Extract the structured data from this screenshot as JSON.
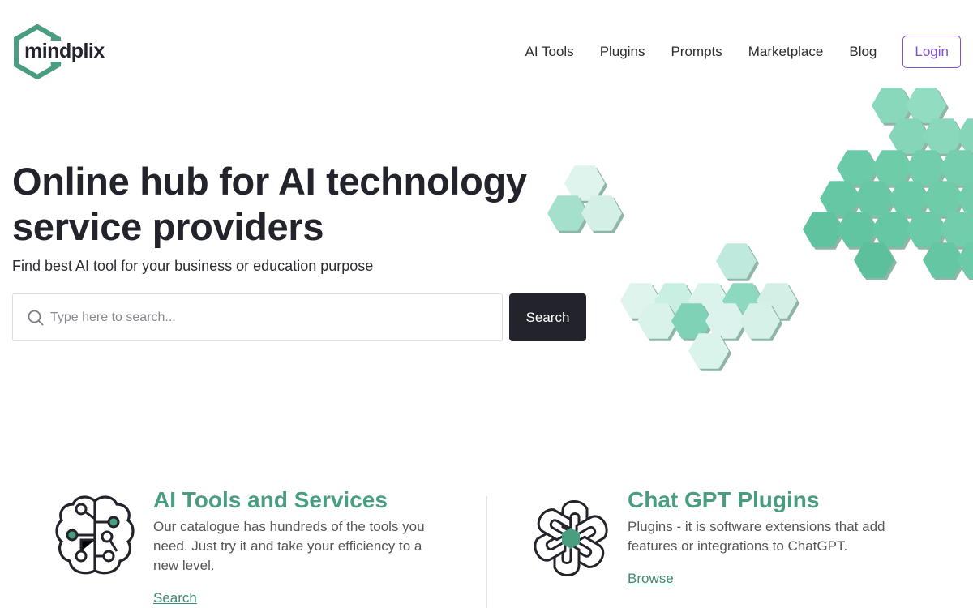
{
  "brand": {
    "name": "mindplix",
    "accent": "#4a9e80",
    "logo_icon": "hexagon-arrows-logo-icon"
  },
  "nav": {
    "items": [
      {
        "label": "AI Tools"
      },
      {
        "label": "Plugins"
      },
      {
        "label": "Prompts"
      },
      {
        "label": "Marketplace"
      },
      {
        "label": "Blog"
      }
    ],
    "login_label": "Login",
    "login_color": "#7d4fd0"
  },
  "hero": {
    "title_line1": "Online hub for AI technology",
    "title_line2": "service providers",
    "subtitle": "Find best AI tool for your business or education purpose",
    "search": {
      "placeholder": "Type here to search...",
      "value": "",
      "button_label": "Search",
      "icon": "search-icon"
    },
    "illustration": "hexagon-cluster-illustration"
  },
  "features": [
    {
      "icon": "brain-circuit-icon",
      "title": "AI Tools and Services",
      "description_lines": [
        "Our catalogue has hundreds of the tools you",
        "need. Just try it and take your efficiency to a",
        "new level."
      ],
      "link_label": "Search"
    },
    {
      "icon": "chatgpt-logo-icon",
      "title": "Chat GPT Plugins",
      "description_lines": [
        "Plugins - it is software extensions that add",
        "features or integrations to ChatGPT."
      ],
      "link_label": "Browse"
    }
  ]
}
